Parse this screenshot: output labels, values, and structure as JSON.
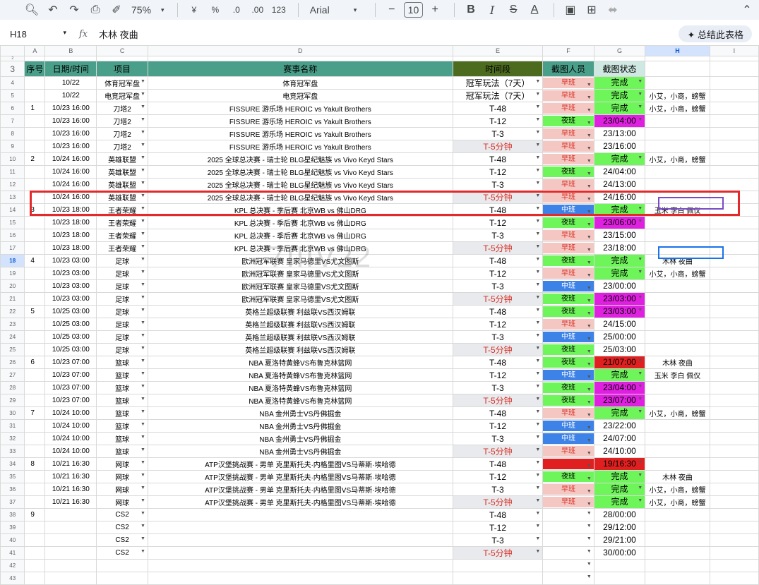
{
  "toolbar": {
    "zoom": "75%",
    "font": "Arial",
    "font_size": "10",
    "currency": "¥",
    "percent": "%",
    "dec_less": ".0",
    "dec_more": ".00",
    "number_fmt": "123"
  },
  "formula": {
    "cell_ref": "H18",
    "fx": "fx",
    "value": "木林 夜曲",
    "summarize": "✦ 总结此表格"
  },
  "columns": [
    "",
    "A",
    "B",
    "C",
    "D",
    "E",
    "F",
    "G",
    "H",
    "I"
  ],
  "header": {
    "row_num": "3",
    "seq": "序号",
    "date": "日期/时间",
    "item": "项目",
    "event": "赛事名称",
    "period": "时间段",
    "person": "截图人员",
    "status": "截图状态"
  },
  "rows": [
    {
      "n": "4",
      "a": "",
      "b": "10/22",
      "c": "体育冠军盘",
      "d": "体育冠军盘",
      "e": "冠军玩法（7天）",
      "f": "早班",
      "ft": "pink",
      "g": "完成",
      "gt": "green",
      "h": ""
    },
    {
      "n": "5",
      "a": "",
      "b": "10/22",
      "c": "电竞冠军盘",
      "d": "电竞冠军盘",
      "e": "冠军玩法（7天）",
      "f": "早班",
      "ft": "pink",
      "g": "完成",
      "gt": "green",
      "h": "小艾，小商，螃蟹"
    },
    {
      "n": "6",
      "a": "1",
      "b": "10/23 16:00",
      "c": "刀塔2",
      "d": "FISSURE 游乐场 HEROIC vs Yakult Brothers",
      "e": "T-48",
      "f": "早班",
      "ft": "pink",
      "g": "完成",
      "gt": "green",
      "h": "小艾，小商，螃蟹"
    },
    {
      "n": "7",
      "a": "",
      "b": "10/23 16:00",
      "c": "刀塔2",
      "d": "FISSURE 游乐场 HEROIC vs Yakult Brothers",
      "e": "T-12",
      "f": "夜班",
      "ft": "green",
      "g": "23/04:00",
      "gt": "mag",
      "h": ""
    },
    {
      "n": "8",
      "a": "",
      "b": "10/23 16:00",
      "c": "刀塔2",
      "d": "FISSURE 游乐场 HEROIC vs Yakult Brothers",
      "e": "T-3",
      "f": "早班",
      "ft": "pink",
      "g": "23/13:00",
      "gt": "",
      "h": ""
    },
    {
      "n": "9",
      "a": "",
      "b": "10/23 16:00",
      "c": "刀塔2",
      "d": "FISSURE 游乐场 HEROIC vs Yakult Brothers",
      "e": "T-5分钟",
      "et": "grey",
      "f": "早班",
      "ft": "pink",
      "g": "23/16:00",
      "gt": "",
      "h": ""
    },
    {
      "n": "10",
      "a": "2",
      "b": "10/24 16:00",
      "c": "英雄联盟",
      "d": "2025 全球总决赛 - 瑞士轮 BLG星纪魅族 vs Vivo Keyd Stars",
      "e": "T-48",
      "f": "早班",
      "ft": "pink",
      "g": "完成",
      "gt": "green",
      "h": "小艾，小商，螃蟹"
    },
    {
      "n": "11",
      "a": "",
      "b": "10/24 16:00",
      "c": "英雄联盟",
      "d": "2025 全球总决赛 - 瑞士轮 BLG星纪魅族 vs Vivo Keyd Stars",
      "e": "T-12",
      "f": "夜班",
      "ft": "green",
      "g": "24/04:00",
      "gt": "",
      "h": ""
    },
    {
      "n": "12",
      "a": "",
      "b": "10/24 16:00",
      "c": "英雄联盟",
      "d": "2025 全球总决赛 - 瑞士轮 BLG星纪魅族 vs Vivo Keyd Stars",
      "e": "T-3",
      "f": "早班",
      "ft": "pink",
      "g": "24/13:00",
      "gt": "",
      "h": ""
    },
    {
      "n": "13",
      "a": "",
      "b": "10/24 16:00",
      "c": "英雄联盟",
      "d": "2025 全球总决赛 - 瑞士轮 BLG星纪魅族 vs Vivo Keyd Stars",
      "e": "T-5分钟",
      "et": "grey",
      "f": "早班",
      "ft": "pink",
      "g": "24/16:00",
      "gt": "",
      "h": ""
    },
    {
      "n": "14",
      "a": "3",
      "b": "10/23 18:00",
      "c": "王者荣耀",
      "d": "KPL 总决赛 - 季后赛 北京WB vs 佛山DRG",
      "e": "T-48",
      "f": "中班",
      "ft": "blue",
      "g": "完成",
      "gt": "green",
      "h": "玉米 李白 佩仪"
    },
    {
      "n": "15",
      "a": "",
      "b": "10/23 18:00",
      "c": "王者荣耀",
      "d": "KPL 总决赛 - 季后赛 北京WB vs 佛山DRG",
      "e": "T-12",
      "f": "夜班",
      "ft": "green",
      "g": "23/06:00",
      "gt": "mag",
      "h": ""
    },
    {
      "n": "16",
      "a": "",
      "b": "10/23 18:00",
      "c": "王者荣耀",
      "d": "KPL 总决赛 - 季后赛 北京WB vs 佛山DRG",
      "e": "T-3",
      "f": "早班",
      "ft": "pink",
      "g": "23/15:00",
      "gt": "",
      "h": ""
    },
    {
      "n": "17",
      "a": "",
      "b": "10/23 18:00",
      "c": "王者荣耀",
      "d": "KPL 总决赛 - 季后赛 北京WB vs 佛山DRG",
      "e": "T-5分钟",
      "et": "grey",
      "f": "早班",
      "ft": "pink",
      "g": "23/18:00",
      "gt": "",
      "h": ""
    },
    {
      "n": "18",
      "a": "4",
      "b": "10/23 03:00",
      "c": "足球",
      "d": "欧洲冠军联赛 皇家马德里VS尤文图斯",
      "e": "T-48",
      "f": "夜班",
      "ft": "green",
      "g": "完成",
      "gt": "green",
      "h": "木林 夜曲"
    },
    {
      "n": "19",
      "a": "",
      "b": "10/23 03:00",
      "c": "足球",
      "d": "欧洲冠军联赛 皇家马德里VS尤文图斯",
      "e": "T-12",
      "f": "早班",
      "ft": "pink",
      "g": "完成",
      "gt": "green",
      "h": "小艾，小商，螃蟹"
    },
    {
      "n": "20",
      "a": "",
      "b": "10/23 03:00",
      "c": "足球",
      "d": "欧洲冠军联赛 皇家马德里VS尤文图斯",
      "e": "T-3",
      "f": "中班",
      "ft": "blue",
      "g": "23/00:00",
      "gt": "",
      "h": ""
    },
    {
      "n": "21",
      "a": "",
      "b": "10/23 03:00",
      "c": "足球",
      "d": "欧洲冠军联赛 皇家马德里VS尤文图斯",
      "e": "T-5分钟",
      "et": "grey",
      "f": "夜班",
      "ft": "green",
      "g": "23/03:00",
      "gt": "mag",
      "h": ""
    },
    {
      "n": "22",
      "a": "5",
      "b": "10/25 03:00",
      "c": "足球",
      "d": "英格兰超级联赛 利兹联VS西汉姆联",
      "e": "T-48",
      "f": "夜班",
      "ft": "green",
      "g": "23/03:00",
      "gt": "mag",
      "h": ""
    },
    {
      "n": "23",
      "a": "",
      "b": "10/25 03:00",
      "c": "足球",
      "d": "英格兰超级联赛 利兹联VS西汉姆联",
      "e": "T-12",
      "f": "早班",
      "ft": "pink",
      "g": "24/15:00",
      "gt": "",
      "h": ""
    },
    {
      "n": "24",
      "a": "",
      "b": "10/25 03:00",
      "c": "足球",
      "d": "英格兰超级联赛 利兹联VS西汉姆联",
      "e": "T-3",
      "f": "中班",
      "ft": "blue",
      "g": "25/00:00",
      "gt": "",
      "h": ""
    },
    {
      "n": "25",
      "a": "",
      "b": "10/25 03:00",
      "c": "足球",
      "d": "英格兰超级联赛 利兹联VS西汉姆联",
      "e": "T-5分钟",
      "et": "grey",
      "f": "夜班",
      "ft": "green",
      "g": "25/03:00",
      "gt": "",
      "h": ""
    },
    {
      "n": "26",
      "a": "6",
      "b": "10/23 07:00",
      "c": "篮球",
      "d": "NBA 夏洛特黄蜂VS布鲁克林篮网",
      "e": "T-48",
      "f": "夜班",
      "ft": "green",
      "g": "21/07:00",
      "gt": "red",
      "h": "木林 夜曲"
    },
    {
      "n": "27",
      "a": "",
      "b": "10/23 07:00",
      "c": "篮球",
      "d": "NBA 夏洛特黄蜂VS布鲁克林篮网",
      "e": "T-12",
      "f": "中班",
      "ft": "blue",
      "g": "完成",
      "gt": "green",
      "h": "玉米 李白 佩仪"
    },
    {
      "n": "28",
      "a": "",
      "b": "10/23 07:00",
      "c": "篮球",
      "d": "NBA 夏洛特黄蜂VS布鲁克林篮网",
      "e": "T-3",
      "f": "夜班",
      "ft": "green",
      "g": "23/04:00",
      "gt": "mag",
      "h": ""
    },
    {
      "n": "29",
      "a": "",
      "b": "10/23 07:00",
      "c": "篮球",
      "d": "NBA 夏洛特黄蜂VS布鲁克林篮网",
      "e": "T-5分钟",
      "et": "grey",
      "f": "夜班",
      "ft": "green",
      "g": "23/07:00",
      "gt": "mag",
      "h": ""
    },
    {
      "n": "30",
      "a": "7",
      "b": "10/24 10:00",
      "c": "篮球",
      "d": "NBA 金州勇士VS丹佛掘金",
      "e": "T-48",
      "f": "早班",
      "ft": "pink",
      "g": "完成",
      "gt": "green",
      "h": "小艾，小商，螃蟹"
    },
    {
      "n": "31",
      "a": "",
      "b": "10/24 10:00",
      "c": "篮球",
      "d": "NBA 金州勇士VS丹佛掘金",
      "e": "T-12",
      "f": "中班",
      "ft": "blue",
      "g": "23/22:00",
      "gt": "",
      "h": ""
    },
    {
      "n": "32",
      "a": "",
      "b": "10/24 10:00",
      "c": "篮球",
      "d": "NBA 金州勇士VS丹佛掘金",
      "e": "T-3",
      "f": "中班",
      "ft": "blue",
      "g": "24/07:00",
      "gt": "",
      "h": ""
    },
    {
      "n": "33",
      "a": "",
      "b": "10/24 10:00",
      "c": "篮球",
      "d": "NBA 金州勇士VS丹佛掘金",
      "e": "T-5分钟",
      "et": "grey",
      "f": "早班",
      "ft": "pink",
      "g": "24/10:00",
      "gt": "",
      "h": ""
    },
    {
      "n": "34",
      "a": "8",
      "b": "10/21 16:30",
      "c": "网球",
      "d": "ATP汉堡挑战赛 - 男单 克里斯托夫·内格里图VS马蒂斯·埃哈德",
      "e": "T-48",
      "f": "",
      "ft": "red",
      "g": "19/16:30",
      "gt": "red",
      "h": ""
    },
    {
      "n": "35",
      "a": "",
      "b": "10/21 16:30",
      "c": "网球",
      "d": "ATP汉堡挑战赛 - 男单 克里斯托夫·内格里图VS马蒂斯·埃哈德",
      "e": "T-12",
      "f": "夜班",
      "ft": "green",
      "g": "完成",
      "gt": "green",
      "h": "木林 夜曲"
    },
    {
      "n": "36",
      "a": "",
      "b": "10/21 16:30",
      "c": "网球",
      "d": "ATP汉堡挑战赛 - 男单 克里斯托夫·内格里图VS马蒂斯·埃哈德",
      "e": "T-3",
      "f": "早班",
      "ft": "pink",
      "g": "完成",
      "gt": "green",
      "h": "小艾，小商，螃蟹"
    },
    {
      "n": "37",
      "a": "",
      "b": "10/21 16:30",
      "c": "网球",
      "d": "ATP汉堡挑战赛 - 男单 克里斯托夫·内格里图VS马蒂斯·埃哈德",
      "e": "T-5分钟",
      "et": "grey",
      "f": "早班",
      "ft": "pink",
      "g": "完成",
      "gt": "green",
      "h": "小艾，小商，螃蟹"
    },
    {
      "n": "38",
      "a": "9",
      "b": "",
      "c": "CS2",
      "d": "",
      "e": "T-48",
      "f": "",
      "ft": "",
      "g": "28/00:00",
      "gt": "",
      "h": ""
    },
    {
      "n": "39",
      "a": "",
      "b": "",
      "c": "CS2",
      "d": "",
      "e": "T-12",
      "f": "",
      "ft": "",
      "g": "29/12:00",
      "gt": "",
      "h": ""
    },
    {
      "n": "40",
      "a": "",
      "b": "",
      "c": "CS2",
      "d": "",
      "e": "T-3",
      "f": "",
      "ft": "",
      "g": "29/21:00",
      "gt": "",
      "h": ""
    },
    {
      "n": "41",
      "a": "",
      "b": "",
      "c": "CS2",
      "d": "",
      "e": "T-5分钟",
      "et": "grey",
      "f": "",
      "ft": "",
      "g": "30/00:00",
      "gt": "",
      "h": ""
    },
    {
      "n": "42",
      "a": "",
      "b": "",
      "c": "",
      "d": "",
      "e": "",
      "f": "",
      "ft": "",
      "g": "",
      "gt": "",
      "h": ""
    },
    {
      "n": "43",
      "a": "",
      "b": "",
      "c": "",
      "d": "",
      "e": "",
      "f": "",
      "ft": "",
      "g": "",
      "gt": "",
      "h": ""
    }
  ],
  "watermark": "7IIIV22",
  "colors": {
    "header_teal": "#4a9f8a",
    "header_olive": "#4d6b1e",
    "chip_green": "#6ef55a",
    "chip_pink": "#f4c7c3",
    "chip_blue": "#3d82e6",
    "chip_magenta": "#e020e0",
    "chip_red": "#e02020",
    "highlight_red": "#e32929"
  }
}
